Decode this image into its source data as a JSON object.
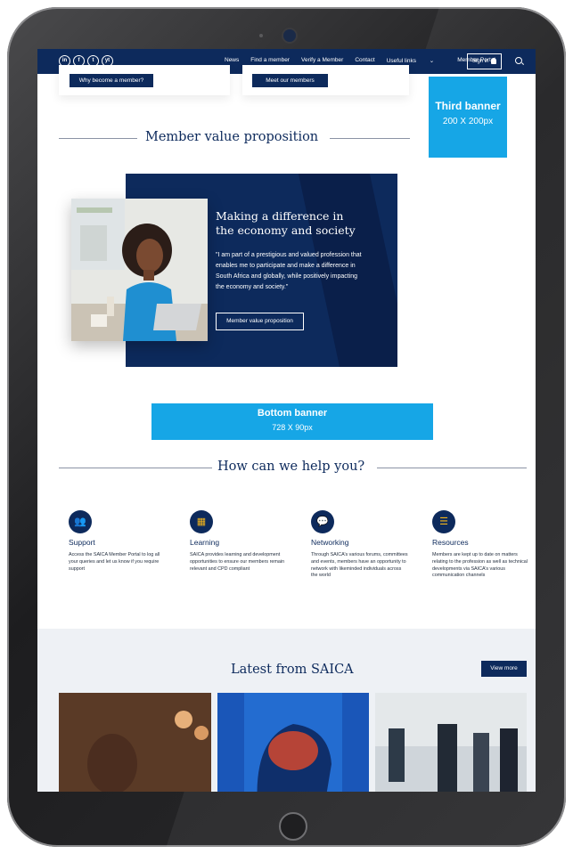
{
  "nav": {
    "social": [
      "in",
      "f",
      "t",
      "yt"
    ],
    "links": [
      "News",
      "Find a member",
      "Verify a Member",
      "Contact",
      "Useful links",
      "Member Portal"
    ],
    "signin": "Sign in"
  },
  "top_cards": {
    "button1": "Why become a member?",
    "button2": "Meet our members"
  },
  "third_banner": {
    "title": "Third banner",
    "size": "200 X 200px"
  },
  "mvp": {
    "section_title": "Member value proposition",
    "heading_line1": "Making a difference in",
    "heading_line2": "the economy and society",
    "quote": "\"I am part of a prestigious and valued profession that enables me to participate and make a difference in South Africa and globally, while positively impacting the economy and society.\"",
    "button": "Member value proposition"
  },
  "bottom_banner": {
    "title": "Bottom banner",
    "size": "728 X 90px"
  },
  "help": {
    "title": "How can we help you?",
    "items": [
      {
        "title": "Support",
        "text": "Access the SAICA Member Portal to log all your queries and let us know if you require support"
      },
      {
        "title": "Learning",
        "text": "SAICA provides learning and development opportunities to ensure our members remain relevant and CPD compliant"
      },
      {
        "title": "Networking",
        "text": "Through SAICA’s various forums, committees and events, members have an opportunity to network with likeminded individuals across the world"
      },
      {
        "title": "Resources",
        "text": "Members are kept up to date on matters relating to the profession as well as technical developments via SAICA’s various communication channels"
      }
    ]
  },
  "latest": {
    "title": "Latest from SAICA",
    "view_more": "View more"
  },
  "colors": {
    "navy": "#0d2a5c",
    "banner_blue": "#16a6e6",
    "icon_accent": "#f3b51b",
    "latest_bg": "#eef1f5"
  }
}
